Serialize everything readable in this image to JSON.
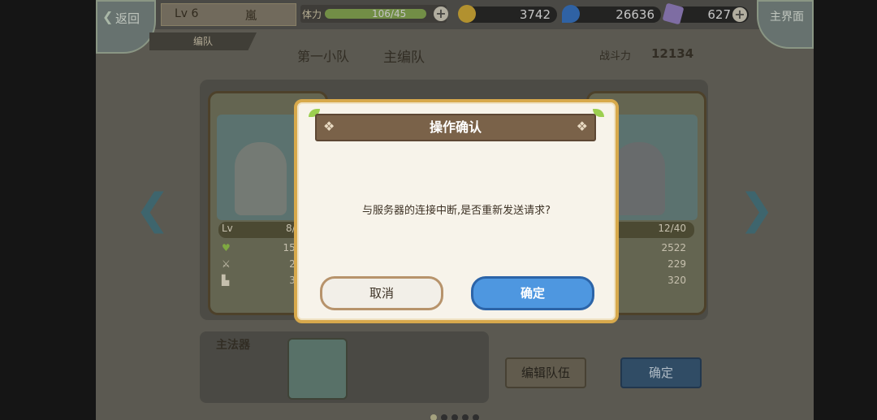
{
  "topbar": {
    "back_label": "返回",
    "level": "Lv 6",
    "player_name": "嵐",
    "stamina_label": "体力",
    "stamina_value": "106/45",
    "stamina_fill": 1.0,
    "gold": "3742",
    "water": "26636",
    "crystal": "627",
    "main_menu_label": "主界面"
  },
  "header": {
    "formation_label": "编队",
    "tab_first_squad": "第一小队",
    "tab_main_formation": "主编队",
    "power_label": "战斗力",
    "power_value": "12134"
  },
  "cards": [
    {
      "lv_label": "Lv",
      "lv": "8/40",
      "hp": "1567",
      "atk": "213",
      "def": "350"
    },
    {
      "lv_label": "Lv",
      "lv": "12/40",
      "hp": "2522",
      "atk": "229",
      "def": "320"
    }
  ],
  "bottom": {
    "artifact_label": "主法器",
    "edit_team_label": "编辑队伍",
    "confirm_label": "确定"
  },
  "dialog": {
    "title": "操作确认",
    "message": "与服务器的连接中断,是否重新发送请求?",
    "cancel_label": "取消",
    "confirm_label": "确定"
  },
  "colors": {
    "gold_icon": "#d9b13a",
    "water_icon": "#3a78c9",
    "crystal_icon": "#9a86c7",
    "confirm_button": "#4e97e0"
  },
  "icons": [
    "back-chevron-icon",
    "gold-coin-icon",
    "water-drop-icon",
    "crystal-icon",
    "plus-icon",
    "heart-icon",
    "sword-icon",
    "boot-icon",
    "left-arrow-icon",
    "right-arrow-icon"
  ]
}
